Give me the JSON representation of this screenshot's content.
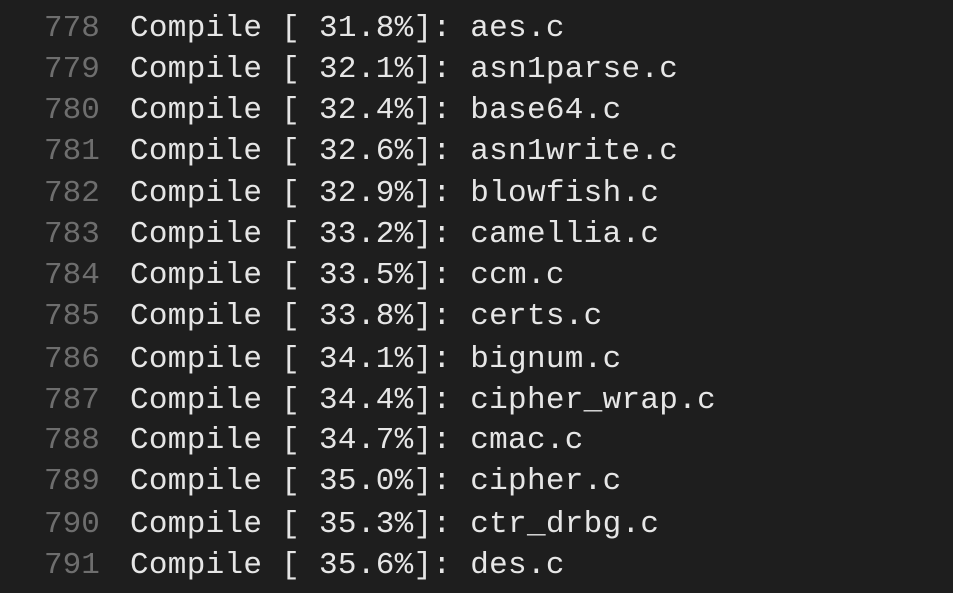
{
  "terminal": {
    "lines": [
      {
        "num": "778",
        "text": "Compile [ 31.8%]: aes.c"
      },
      {
        "num": "779",
        "text": "Compile [ 32.1%]: asn1parse.c"
      },
      {
        "num": "780",
        "text": "Compile [ 32.4%]: base64.c"
      },
      {
        "num": "781",
        "text": "Compile [ 32.6%]: asn1write.c"
      },
      {
        "num": "782",
        "text": "Compile [ 32.9%]: blowfish.c"
      },
      {
        "num": "783",
        "text": "Compile [ 33.2%]: camellia.c"
      },
      {
        "num": "784",
        "text": "Compile [ 33.5%]: ccm.c"
      },
      {
        "num": "785",
        "text": "Compile [ 33.8%]: certs.c"
      },
      {
        "num": "786",
        "text": "Compile [ 34.1%]: bignum.c"
      },
      {
        "num": "787",
        "text": "Compile [ 34.4%]: cipher_wrap.c"
      },
      {
        "num": "788",
        "text": "Compile [ 34.7%]: cmac.c"
      },
      {
        "num": "789",
        "text": "Compile [ 35.0%]: cipher.c"
      },
      {
        "num": "790",
        "text": "Compile [ 35.3%]: ctr_drbg.c"
      },
      {
        "num": "791",
        "text": "Compile [ 35.6%]: des.c"
      }
    ]
  },
  "colors": {
    "background": "#1e1e1e",
    "line_number": "#6e6e6e",
    "text": "#e6e6e6"
  }
}
